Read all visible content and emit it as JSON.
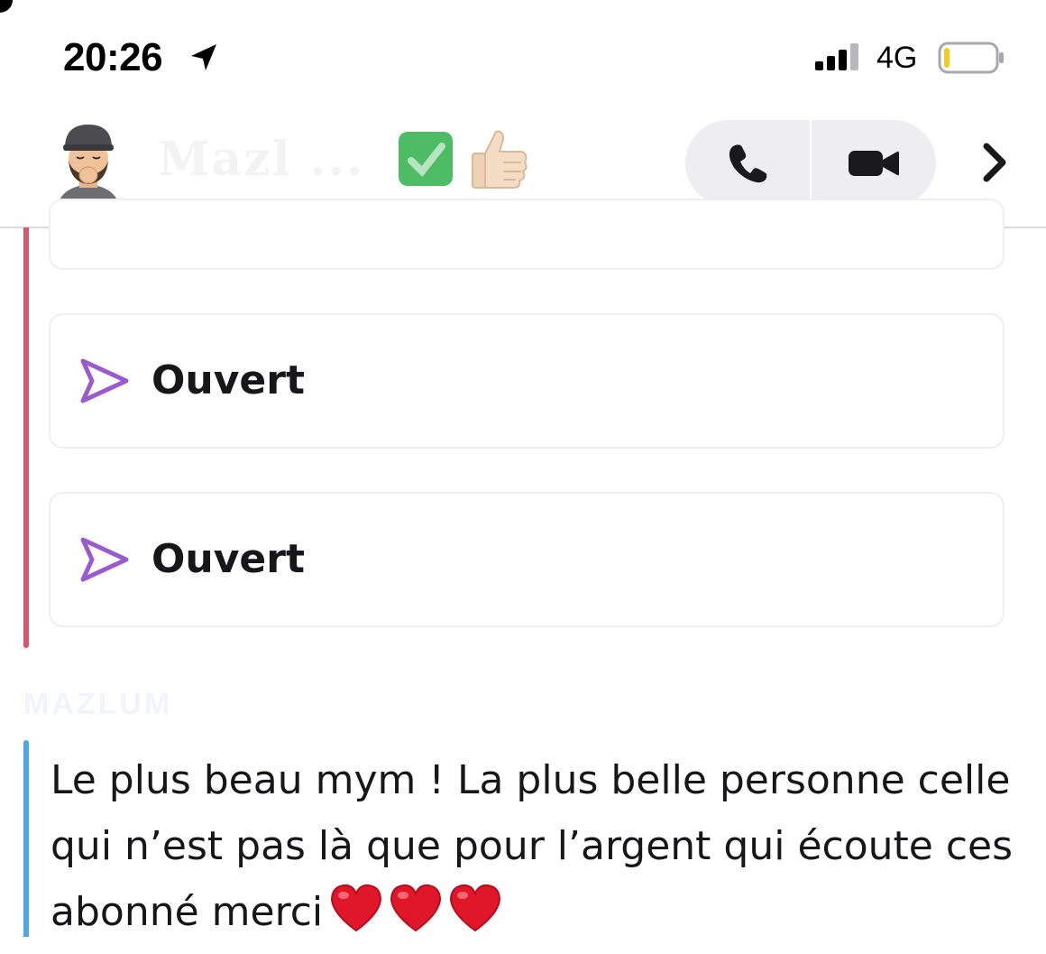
{
  "status_bar": {
    "time": "20:26",
    "network": "4G",
    "location_icon": "location-arrow-icon",
    "signal_icon": "cellular-signal-icon",
    "battery_icon": "battery-low-icon",
    "battery_level": 0.12
  },
  "header": {
    "contact_name": "Mazl ...",
    "avatar_icon": "bitmoji-avatar",
    "badge_icon": "green-check-emoji",
    "reaction_icon": "thumbs-up-emoji",
    "audio_call_icon": "phone-icon",
    "video_call_icon": "video-camera-icon",
    "more_icon": "chevron-right-icon"
  },
  "messages": {
    "snaps": [
      {
        "label": "Ouvert",
        "icon": "send-arrow-icon",
        "color": "#9b5bd0"
      },
      {
        "label": "Ouvert",
        "icon": "send-arrow-icon",
        "color": "#9b5bd0"
      }
    ],
    "sender_name": "MAZLUM",
    "text": "Le plus beau mym ! La plus belle personne celle qui n’est pas là que pour l’argent qui écoute ces abonné merci",
    "emoji": "❤️❤️❤️"
  },
  "colors": {
    "thread_me": "#d6566d",
    "thread_them": "#4ea8e4",
    "card_border": "#efeff1",
    "call_group_bg": "#eeeef0"
  }
}
